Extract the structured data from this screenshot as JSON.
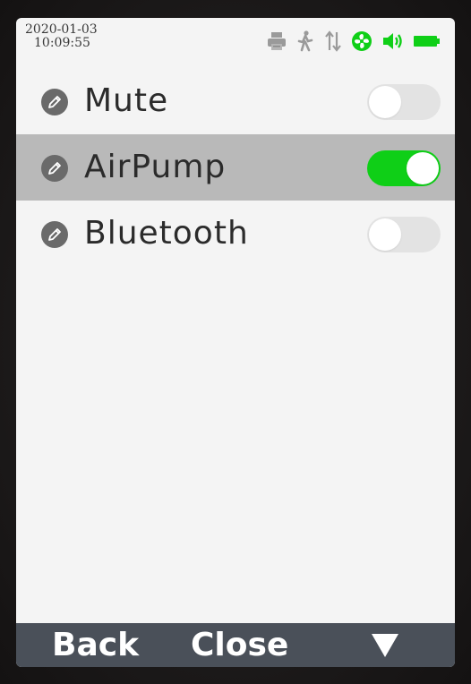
{
  "status": {
    "date": "2020-01-03",
    "time": "10:09:55",
    "icons": [
      "printer-icon",
      "walking-person-icon",
      "arrows-up-down-icon",
      "fan-icon",
      "speaker-icon",
      "battery-icon"
    ],
    "active_icon_color": "#0fcf17"
  },
  "settings": {
    "items": [
      {
        "label": "Mute",
        "on": false
      },
      {
        "label": "AirPump",
        "on": true
      },
      {
        "label": "Bluetooth",
        "on": false
      }
    ],
    "selected_index": 1,
    "toggle_on_color": "#0fcf17"
  },
  "softkeys": {
    "back_label": "Back",
    "close_label": "Close",
    "down_icon": "triangle-down-icon"
  }
}
